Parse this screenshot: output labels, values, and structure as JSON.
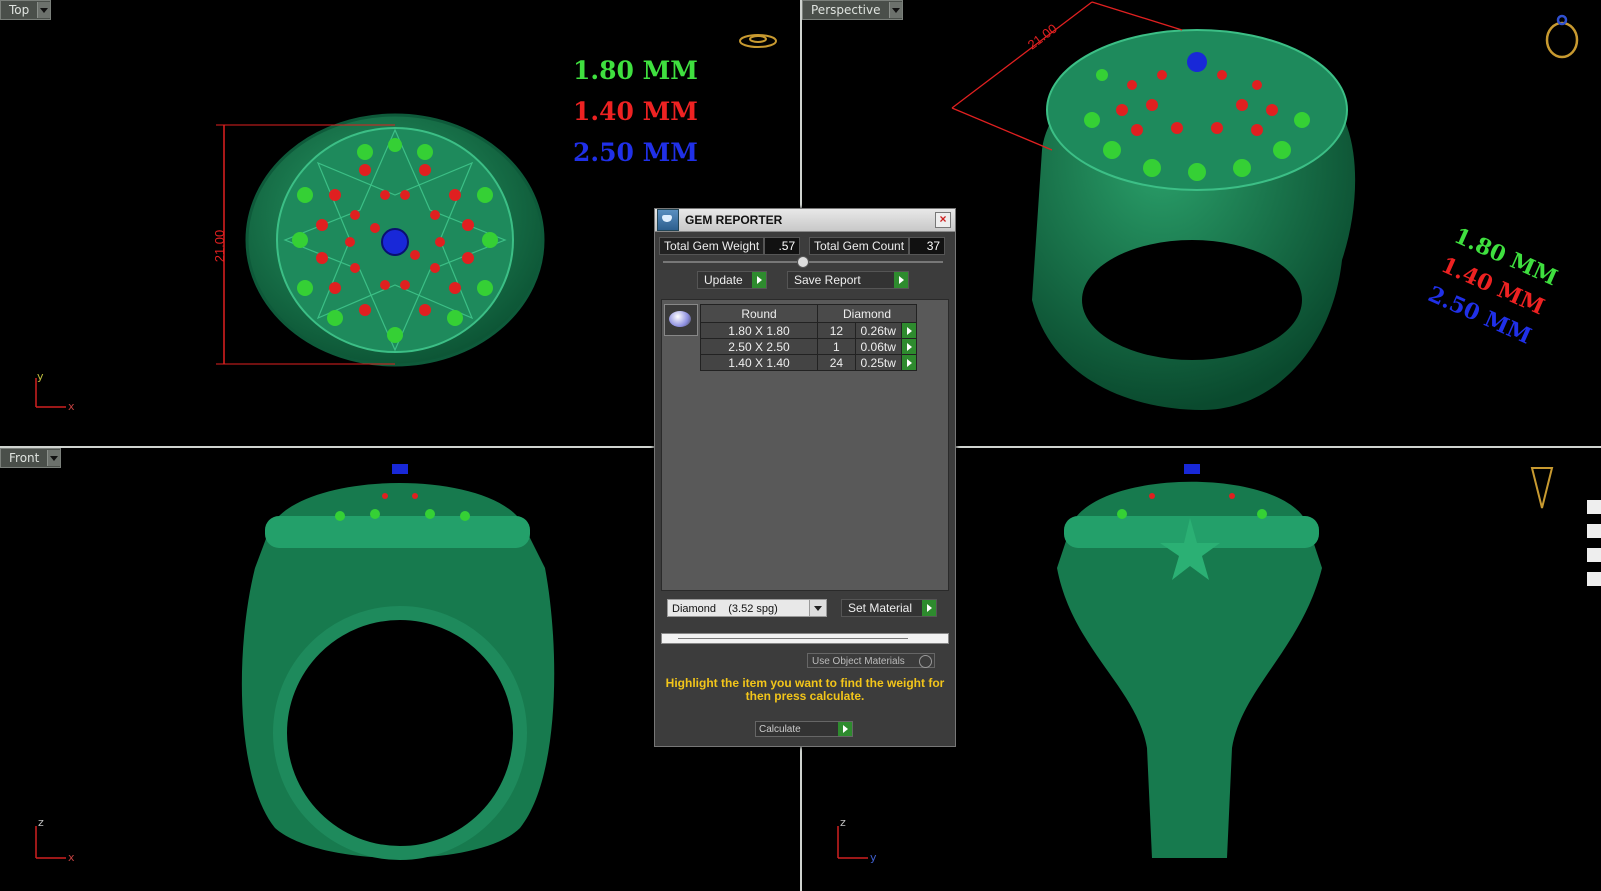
{
  "viewports": {
    "top": {
      "label": "Top",
      "dimension": "21.00",
      "axis_y": "y",
      "axis_x": "x"
    },
    "perspective": {
      "label": "Perspective",
      "dimension": "21.00"
    },
    "front": {
      "label": "Front",
      "axis_z": "z",
      "axis_x": "x"
    },
    "right": {
      "axis_z": "z",
      "axis_y": "y"
    }
  },
  "legend": {
    "green": "1.80 MM",
    "red": "1.40 MM",
    "blue": "2.50 MM"
  },
  "dialog": {
    "title": "GEM REPORTER",
    "total_weight_label": "Total Gem Weight",
    "total_weight_value": ".57",
    "total_count_label": "Total Gem Count",
    "total_count_value": "37",
    "update_label": "Update",
    "save_report_label": "Save Report",
    "table": {
      "headers": [
        "Round",
        "Diamond"
      ],
      "rows": [
        {
          "size": "1.80 X 1.80",
          "count": "12",
          "weight": "0.26tw"
        },
        {
          "size": "2.50 X 2.50",
          "count": "1",
          "weight": "0.06tw"
        },
        {
          "size": "1.40 X 1.40",
          "count": "24",
          "weight": "0.25tw"
        }
      ]
    },
    "material_select": "Diamond    (3.52 spg)",
    "set_material_label": "Set Material",
    "use_object_materials": "Use Object Materials",
    "hint": "Highlight the item you want to find the weight for then press calculate.",
    "calculate_label": "Calculate"
  },
  "colors": {
    "ring": "#1f8a5a",
    "gem_green": "#3fe03f",
    "gem_red": "#ee2222",
    "gem_blue": "#2030e8",
    "accent_go": "#2e8b2e"
  }
}
